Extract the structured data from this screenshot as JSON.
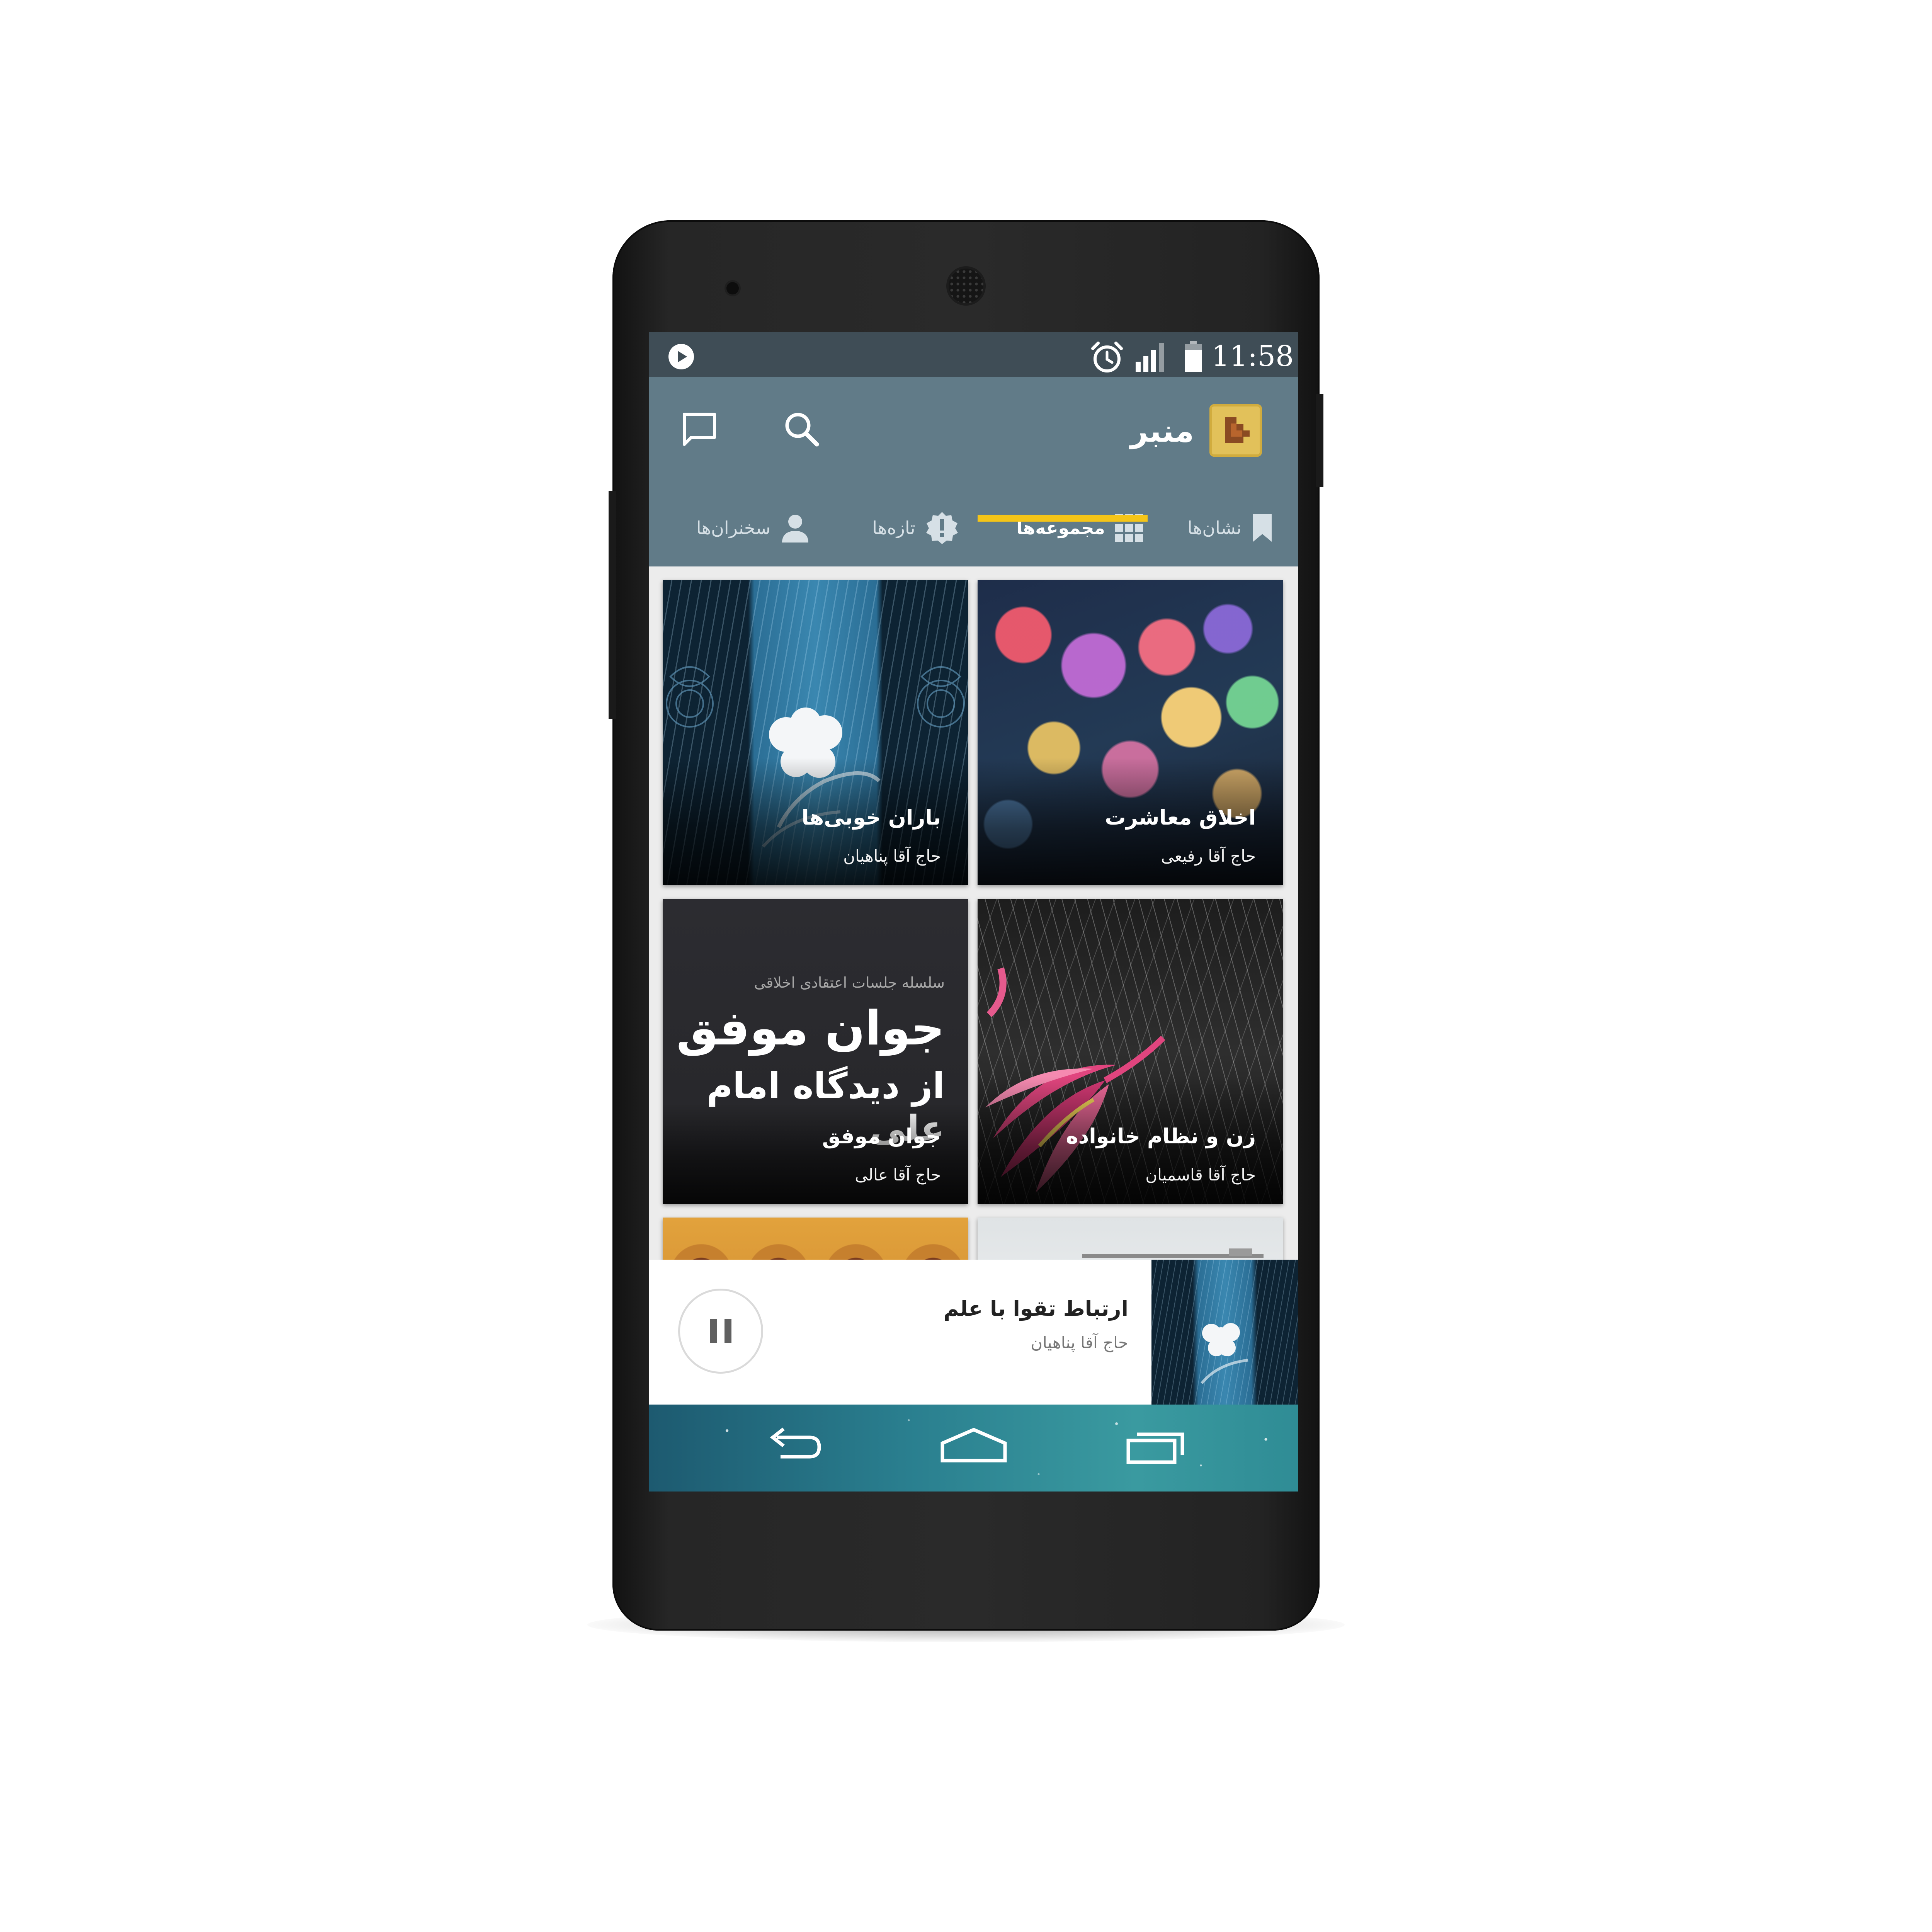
{
  "status_bar": {
    "time": "11:58",
    "icons": [
      "play-notification-icon",
      "alarm-icon",
      "signal-icon",
      "battery-icon"
    ]
  },
  "app_bar": {
    "title": "منبر",
    "actions": [
      "search-icon",
      "chat-icon"
    ]
  },
  "tabs": [
    {
      "label": "نشان‌ها",
      "icon": "bookmark-icon",
      "active": false
    },
    {
      "label": "مجموعه‌ها",
      "icon": "grid-icon",
      "active": true
    },
    {
      "label": "تازه‌ها",
      "icon": "new-badge-icon",
      "active": false
    },
    {
      "label": "سخنران‌ها",
      "icon": "person-icon",
      "active": false
    }
  ],
  "collections": [
    {
      "title": "اخلاق معاشرت",
      "speaker": "حاج آقا رفیعی"
    },
    {
      "title": "باران خوبی‌ها",
      "speaker": "حاج آقا پناهیان"
    },
    {
      "title": "زن و نظام خانواده",
      "speaker": "حاج آقا قاسمیان"
    },
    {
      "title": "جوان موفق",
      "speaker": "حاج آقا عالی"
    }
  ],
  "poster_text": {
    "series": "سلسله جلسات اعتقادی اخلاقی",
    "line1": "جوان موفق",
    "line2": "از دیدگاه امام علی"
  },
  "now_playing": {
    "title": "ارتباط تقوا با علم",
    "speaker": "حاج آقا پناهیان",
    "state": "playing"
  },
  "nav_bar": [
    "back-icon",
    "home-icon",
    "recents-icon"
  ],
  "colors": {
    "status_bar": "#3f4d56",
    "app_bar": "#617b88",
    "tab_indicator": "#f5c518",
    "logo": "#e2c15a"
  }
}
